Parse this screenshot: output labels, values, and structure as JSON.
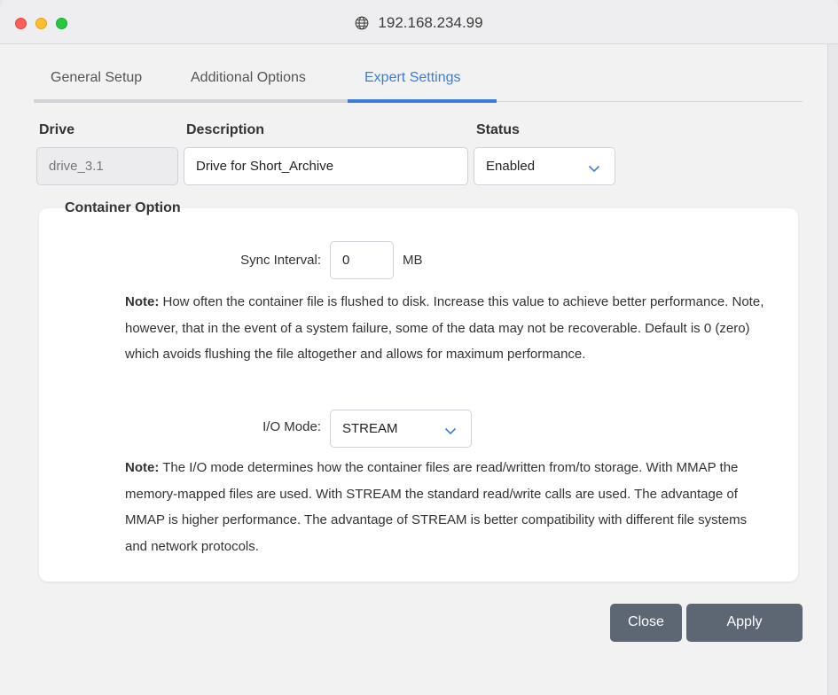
{
  "window": {
    "title": "192.168.234.99"
  },
  "tabs": [
    {
      "label": "General Setup"
    },
    {
      "label": "Additional Options"
    },
    {
      "label": "Expert Settings"
    }
  ],
  "fields": {
    "drive": {
      "label": "Drive",
      "value": "drive_3.1"
    },
    "description": {
      "label": "Description",
      "value": "Drive for Short_Archive"
    },
    "status": {
      "label": "Status",
      "value": "Enabled"
    }
  },
  "container": {
    "legend": "Container Option",
    "sync": {
      "label": "Sync Interval:",
      "value": "0",
      "unit": "MB"
    },
    "sync_note": {
      "prefix": "Note:",
      "text": " How often the container file is flushed to disk. Increase this value to achieve better performance. Note, however, that in the event of a system failure, some of the data may not be recoverable. Default is 0 (zero) which avoids flushing the file altogether and allows for maximum performance."
    },
    "io": {
      "label": "I/O Mode:",
      "value": "STREAM"
    },
    "io_note": {
      "prefix": "Note:",
      "text": " The I/O mode determines how the container files are read/written from/to storage. With MMAP the memory-mapped files are used. With STREAM the standard read/write calls are used. The advantage of MMAP is higher performance. The advantage of STREAM is better compatibility with different file systems and network protocols."
    }
  },
  "buttons": {
    "close": "Close",
    "apply": "Apply"
  },
  "colors": {
    "accent": "#3b7dd8",
    "button": "#5d6673"
  }
}
